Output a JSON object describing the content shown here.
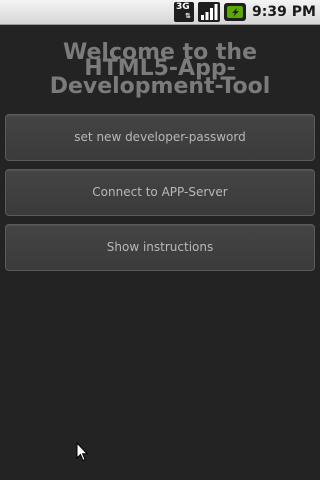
{
  "status_bar": {
    "network_type": "3G",
    "network_arrows": "⇅",
    "time": "9:39 PM",
    "icons": [
      "network-3g-icon",
      "signal-strength-icon",
      "battery-charging-icon"
    ]
  },
  "title": {
    "line1": "Welcome to the",
    "line2": "HTML5-App-",
    "line3": "Development-Tool"
  },
  "buttons": [
    {
      "label": "set new developer-password"
    },
    {
      "label": "Connect to APP-Server"
    },
    {
      "label": "Show instructions"
    }
  ],
  "colors": {
    "background": "#232323",
    "button": "#414141",
    "button_text": "#b8b8b8",
    "title_text": "#7b7b7b",
    "status_bar": "#e6e6e6",
    "battery_accent": "#5aa900"
  }
}
